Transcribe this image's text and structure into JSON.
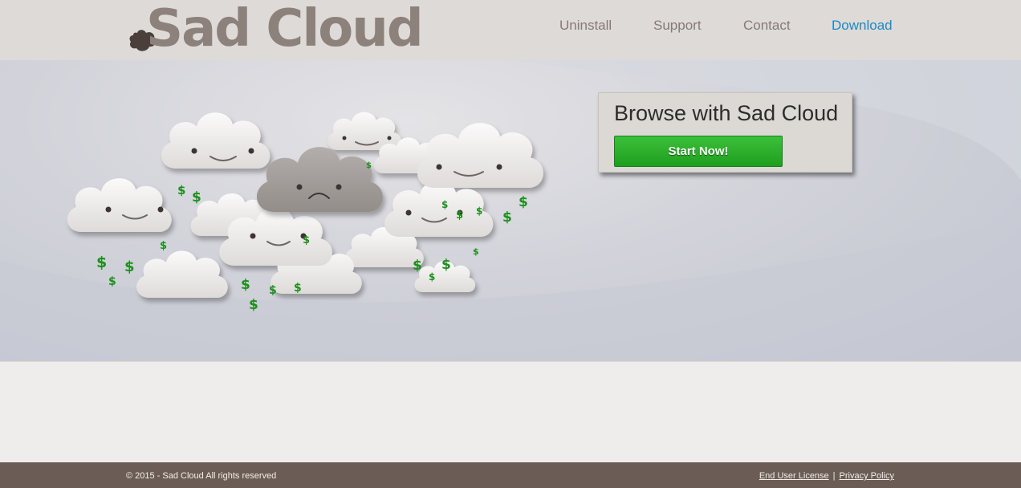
{
  "header": {
    "logo_text": "Sad Cloud",
    "nav": [
      {
        "label": "Uninstall"
      },
      {
        "label": "Support"
      },
      {
        "label": "Contact"
      },
      {
        "label": "Download",
        "active": true
      }
    ]
  },
  "hero": {
    "cta_title": "Browse with Sad Cloud",
    "cta_button": "Start Now!",
    "money_symbol": "$"
  },
  "footer": {
    "copyright": "© 2015 - Sad Cloud All rights reserved",
    "links": [
      {
        "label": "End User License"
      },
      {
        "label": "Privacy Policy"
      }
    ],
    "separator": "|"
  },
  "colors": {
    "header_bg": "#dedad7",
    "logo": "#8c817b",
    "nav": "#857b76",
    "nav_active": "#1a8bc5",
    "cta_button": "#26a624",
    "footer_bg": "#6b5d55",
    "money": "#1e8f1e"
  }
}
